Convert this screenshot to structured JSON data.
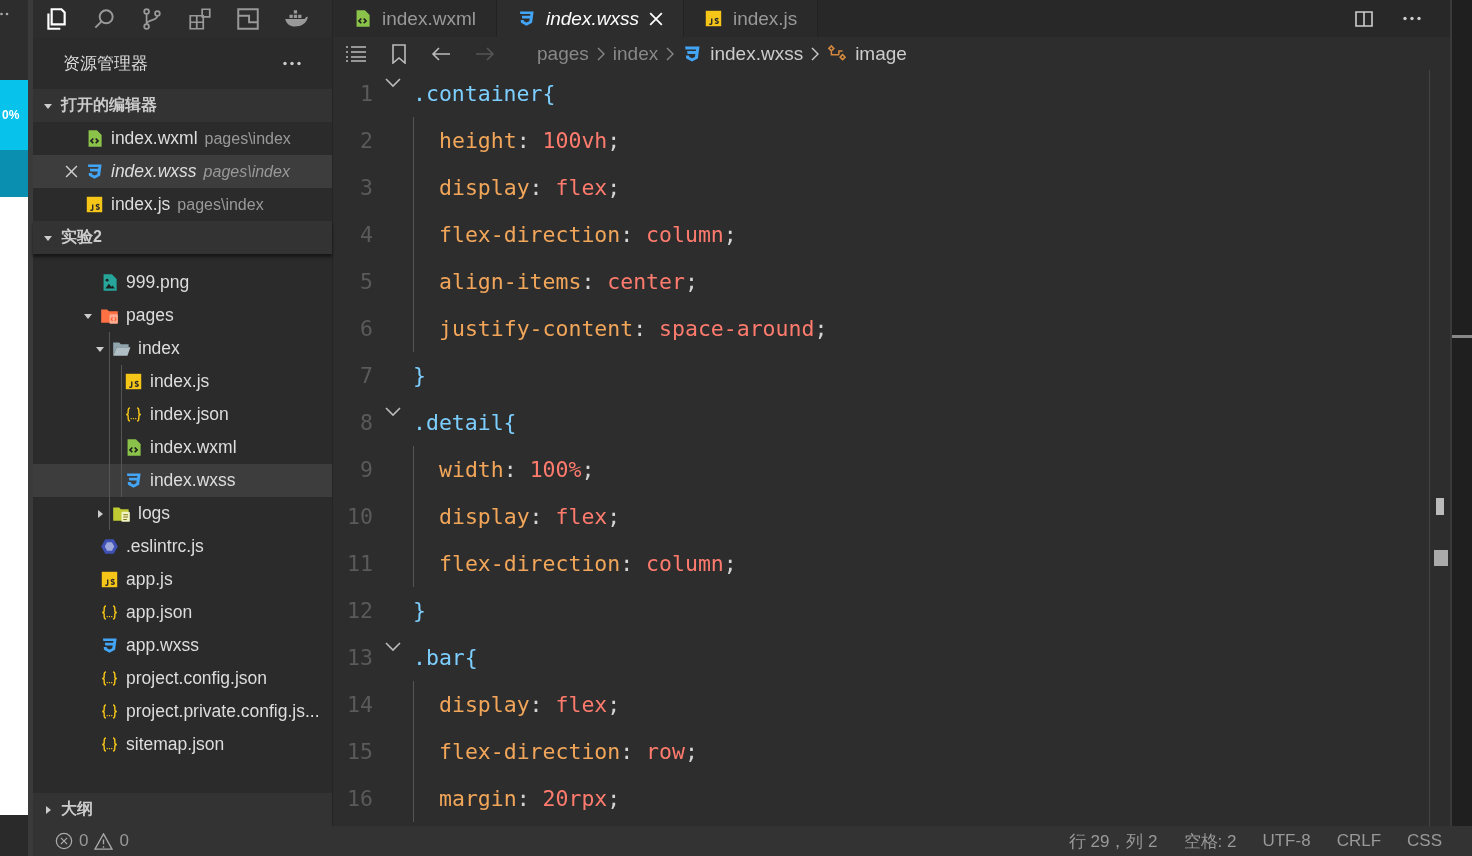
{
  "simulator": {
    "zoom": "0%"
  },
  "explorer": {
    "title": "资源管理器",
    "open_editors": {
      "title": "打开的编辑器",
      "expanded": true,
      "items": [
        {
          "name": "index.wxml",
          "path": "pages\\index",
          "kind": "wxml",
          "selected": false,
          "preview": false
        },
        {
          "name": "index.wxss",
          "path": "pages\\index",
          "kind": "wxss",
          "selected": true,
          "preview": true
        },
        {
          "name": "index.js",
          "path": "pages\\index",
          "kind": "js",
          "selected": false,
          "preview": false
        }
      ]
    },
    "project": {
      "title": "实验2",
      "expanded": true,
      "tree": [
        {
          "name": "999.png",
          "kind": "png",
          "selected": false
        },
        {
          "name": "pages",
          "kind": "folder-pages",
          "expanded": true,
          "selected": false,
          "children": [
            {
              "name": "index",
              "kind": "folder",
              "expanded": true,
              "selected": false,
              "children": [
                {
                  "name": "index.js",
                  "kind": "js",
                  "selected": false
                },
                {
                  "name": "index.json",
                  "kind": "json",
                  "selected": false
                },
                {
                  "name": "index.wxml",
                  "kind": "wxml",
                  "selected": false
                },
                {
                  "name": "index.wxss",
                  "kind": "wxss",
                  "selected": true
                }
              ]
            },
            {
              "name": "logs",
              "kind": "folder-logs",
              "expanded": false,
              "selected": false
            }
          ]
        },
        {
          "name": ".eslintrc.js",
          "kind": "eslint",
          "selected": false
        },
        {
          "name": "app.js",
          "kind": "js",
          "selected": false
        },
        {
          "name": "app.json",
          "kind": "json",
          "selected": false
        },
        {
          "name": "app.wxss",
          "kind": "wxss",
          "selected": false
        },
        {
          "name": "project.config.json",
          "kind": "json",
          "selected": false
        },
        {
          "name": "project.private.config.js...",
          "kind": "json",
          "selected": false
        },
        {
          "name": "sitemap.json",
          "kind": "json",
          "selected": false
        }
      ]
    },
    "outline": {
      "title": "大纲",
      "expanded": false
    }
  },
  "tabs": [
    {
      "label": "index.wxml",
      "kind": "wxml",
      "selected": false,
      "preview": false
    },
    {
      "label": "index.wxss",
      "kind": "wxss",
      "selected": true,
      "preview": true
    },
    {
      "label": "index.js",
      "kind": "js",
      "selected": false,
      "preview": false
    }
  ],
  "nav": {
    "back_enabled": true,
    "forward_enabled": false
  },
  "breadcrumb": [
    {
      "text": "pages",
      "kind": "folder"
    },
    {
      "text": "index",
      "kind": "folder"
    },
    {
      "text": "index.wxss",
      "kind": "wxss"
    },
    {
      "text": "image",
      "kind": "symbol"
    }
  ],
  "code_lines": [
    {
      "number": "1",
      "foldable": true,
      "indented": false,
      "tokens": [
        {
          "kind": "selector",
          "text": ".container"
        },
        {
          "kind": "brace",
          "text": "{"
        }
      ]
    },
    {
      "number": "2",
      "foldable": false,
      "indented": true,
      "tokens": [
        {
          "kind": "property",
          "text": "height"
        },
        {
          "kind": "punct",
          "text": ": "
        },
        {
          "kind": "value",
          "text": "100vh"
        },
        {
          "kind": "punct",
          "text": ";"
        }
      ]
    },
    {
      "number": "3",
      "foldable": false,
      "indented": true,
      "tokens": [
        {
          "kind": "property",
          "text": "display"
        },
        {
          "kind": "punct",
          "text": ": "
        },
        {
          "kind": "value",
          "text": "flex"
        },
        {
          "kind": "punct",
          "text": ";"
        }
      ]
    },
    {
      "number": "4",
      "foldable": false,
      "indented": true,
      "tokens": [
        {
          "kind": "property",
          "text": "flex-direction"
        },
        {
          "kind": "punct",
          "text": ": "
        },
        {
          "kind": "value",
          "text": "column"
        },
        {
          "kind": "punct",
          "text": ";"
        }
      ]
    },
    {
      "number": "5",
      "foldable": false,
      "indented": true,
      "tokens": [
        {
          "kind": "property",
          "text": "align-items"
        },
        {
          "kind": "punct",
          "text": ": "
        },
        {
          "kind": "value",
          "text": "center"
        },
        {
          "kind": "punct",
          "text": ";"
        }
      ]
    },
    {
      "number": "6",
      "foldable": false,
      "indented": true,
      "tokens": [
        {
          "kind": "property",
          "text": "justify-content"
        },
        {
          "kind": "punct",
          "text": ": "
        },
        {
          "kind": "value",
          "text": "space-around"
        },
        {
          "kind": "punct",
          "text": ";"
        }
      ]
    },
    {
      "number": "7",
      "foldable": false,
      "indented": false,
      "tokens": [
        {
          "kind": "brace",
          "text": "}"
        }
      ]
    },
    {
      "number": "8",
      "foldable": true,
      "indented": false,
      "tokens": [
        {
          "kind": "selector",
          "text": ".detail"
        },
        {
          "kind": "brace",
          "text": "{"
        }
      ]
    },
    {
      "number": "9",
      "foldable": false,
      "indented": true,
      "tokens": [
        {
          "kind": "property",
          "text": "width"
        },
        {
          "kind": "punct",
          "text": ": "
        },
        {
          "kind": "value",
          "text": "100%"
        },
        {
          "kind": "punct",
          "text": ";"
        }
      ]
    },
    {
      "number": "10",
      "foldable": false,
      "indented": true,
      "tokens": [
        {
          "kind": "property",
          "text": "display"
        },
        {
          "kind": "punct",
          "text": ": "
        },
        {
          "kind": "value",
          "text": "flex"
        },
        {
          "kind": "punct",
          "text": ";"
        }
      ]
    },
    {
      "number": "11",
      "foldable": false,
      "indented": true,
      "tokens": [
        {
          "kind": "property",
          "text": "flex-direction"
        },
        {
          "kind": "punct",
          "text": ": "
        },
        {
          "kind": "value",
          "text": "column"
        },
        {
          "kind": "punct",
          "text": ";"
        }
      ]
    },
    {
      "number": "12",
      "foldable": false,
      "indented": false,
      "tokens": [
        {
          "kind": "brace",
          "text": "}"
        }
      ]
    },
    {
      "number": "13",
      "foldable": true,
      "indented": false,
      "tokens": [
        {
          "kind": "selector",
          "text": ".bar"
        },
        {
          "kind": "brace",
          "text": "{"
        }
      ]
    },
    {
      "number": "14",
      "foldable": false,
      "indented": true,
      "tokens": [
        {
          "kind": "property",
          "text": "display"
        },
        {
          "kind": "punct",
          "text": ": "
        },
        {
          "kind": "value",
          "text": "flex"
        },
        {
          "kind": "punct",
          "text": ";"
        }
      ]
    },
    {
      "number": "15",
      "foldable": false,
      "indented": true,
      "tokens": [
        {
          "kind": "property",
          "text": "flex-direction"
        },
        {
          "kind": "punct",
          "text": ": "
        },
        {
          "kind": "value",
          "text": "row"
        },
        {
          "kind": "punct",
          "text": ";"
        }
      ]
    },
    {
      "number": "16",
      "foldable": false,
      "indented": true,
      "tokens": [
        {
          "kind": "property",
          "text": "margin"
        },
        {
          "kind": "punct",
          "text": ": "
        },
        {
          "kind": "value",
          "text": "20rpx"
        },
        {
          "kind": "punct",
          "text": ";"
        }
      ]
    }
  ],
  "status_bar": {
    "errors": "0",
    "warnings": "0",
    "position": "行 29，列 2",
    "indent": "空格: 2",
    "encoding": "UTF-8",
    "eol": "CRLF",
    "language": "CSS"
  }
}
